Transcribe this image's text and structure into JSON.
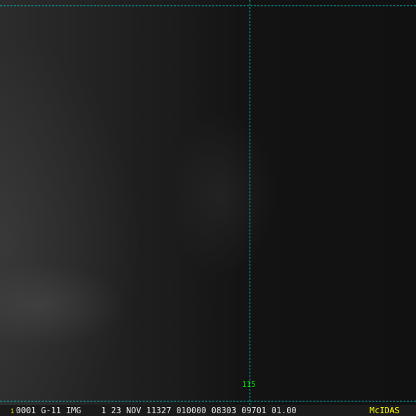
{
  "image": {
    "description_label": "satellite-image"
  },
  "overlay": {
    "longitude_label": "115",
    "line_color": "#00e0e8",
    "label_color": "#00e000"
  },
  "status_bar": {
    "frame_number": "1",
    "info": "0001 G-11 IMG    1 23 NOV 11327 010000 08303 09701 01.00",
    "brand": "McIDAS"
  }
}
